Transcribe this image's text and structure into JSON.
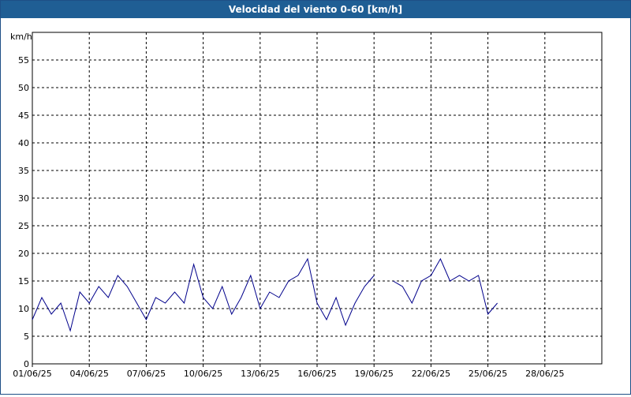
{
  "window": {
    "title": "Velocidad del viento 0-60 [km/h]"
  },
  "chart_data": {
    "type": "line",
    "title": "Velocidad del viento 0-60 [km/h]",
    "ylabel": "km/h",
    "xlabel": "",
    "ylim": [
      0,
      60
    ],
    "yticks": [
      0,
      5,
      10,
      15,
      20,
      25,
      30,
      35,
      40,
      45,
      50,
      55
    ],
    "xlim": [
      "2025-06-01",
      "2025-07-01"
    ],
    "xtick_labels": [
      "01/06/25",
      "04/06/25",
      "07/06/25",
      "10/06/25",
      "13/06/25",
      "16/06/25",
      "19/06/25",
      "22/06/25",
      "25/06/25",
      "28/06/25"
    ],
    "grid": true,
    "line_color": "#00008b",
    "series": [
      {
        "x": [
          "2025-06-01",
          "2025-06-01 12:00",
          "2025-06-02",
          "2025-06-02 12:00",
          "2025-06-03",
          "2025-06-03 12:00",
          "2025-06-04",
          "2025-06-04 12:00",
          "2025-06-05",
          "2025-06-05 12:00",
          "2025-06-06",
          "2025-06-06 12:00",
          "2025-06-07",
          "2025-06-07 12:00",
          "2025-06-08",
          "2025-06-08 12:00",
          "2025-06-09",
          "2025-06-09 12:00",
          "2025-06-10",
          "2025-06-10 12:00",
          "2025-06-11",
          "2025-06-11 12:00",
          "2025-06-12",
          "2025-06-12 12:00",
          "2025-06-13",
          "2025-06-13 12:00",
          "2025-06-14",
          "2025-06-14 12:00",
          "2025-06-15",
          "2025-06-15 12:00",
          "2025-06-16",
          "2025-06-16 12:00",
          "2025-06-17",
          "2025-06-17 12:00",
          "2025-06-18",
          "2025-06-18 12:00",
          "2025-06-19",
          null,
          "2025-06-20",
          "2025-06-20 12:00",
          "2025-06-21",
          "2025-06-21 12:00",
          "2025-06-22",
          "2025-06-22 12:00",
          "2025-06-23",
          "2025-06-23 12:00",
          "2025-06-24",
          "2025-06-24 12:00",
          "2025-06-25",
          "2025-06-25 12:00"
        ],
        "y": [
          8,
          12,
          9,
          11,
          6,
          13,
          11,
          14,
          12,
          16,
          14,
          11,
          8,
          12,
          11,
          13,
          11,
          18,
          12,
          10,
          14,
          9,
          12,
          16,
          10,
          13,
          12,
          15,
          16,
          19,
          11,
          8,
          12,
          7,
          11,
          14,
          16,
          null,
          15,
          14,
          11,
          15,
          16,
          19,
          15,
          16,
          15,
          16,
          9,
          11
        ]
      }
    ]
  }
}
